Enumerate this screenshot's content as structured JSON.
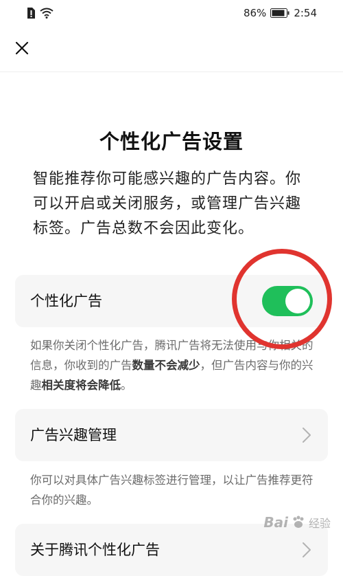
{
  "status_bar": {
    "battery_percent": "86%",
    "time": "2:54"
  },
  "nav": {
    "close_icon": "close-icon"
  },
  "page": {
    "title": "个性化广告设置",
    "description": "智能推荐你可能感兴趣的广告内容。你可以开启或关闭服务，或管理广告兴趣标签。广告总数不会因此变化。"
  },
  "personalized_ads": {
    "label": "个性化广告",
    "toggle_on": true,
    "accent_color": "#1fbf5a",
    "note_part1": "如果你关闭个性化广告，腾讯广告将无法使用与你相关的信息，你收到的广告",
    "note_bold1": "数量不会减少",
    "note_part2": "，但广告内容与你的兴趣",
    "note_bold2": "相关度将会降低",
    "note_part3": "。"
  },
  "interest_management": {
    "label": "广告兴趣管理",
    "note": "你可以对具体广告兴趣标签进行管理，以让广告推荐更符合你的兴趣。"
  },
  "about": {
    "label": "关于腾讯个性化广告"
  },
  "annotation": {
    "circle_color": "#e0342f"
  },
  "watermark": {
    "brand": "Bai",
    "sub": "经验"
  }
}
